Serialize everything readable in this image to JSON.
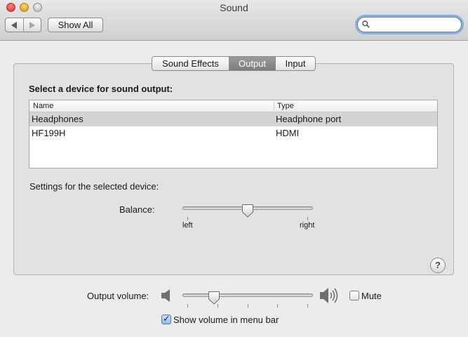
{
  "window": {
    "title": "Sound"
  },
  "toolbar": {
    "back_icon": "chevron-left-icon",
    "forward_icon": "chevron-right-icon",
    "show_all_label": "Show All",
    "search_value": "",
    "search_placeholder": ""
  },
  "tabs": [
    {
      "label": "Sound Effects",
      "selected": false
    },
    {
      "label": "Output",
      "selected": true
    },
    {
      "label": "Input",
      "selected": false
    }
  ],
  "output": {
    "heading": "Select a device for sound output:",
    "columns": {
      "name": "Name",
      "type": "Type"
    },
    "devices": [
      {
        "name": "Headphones",
        "type": "Headphone port",
        "selected": true
      },
      {
        "name": "HF199H",
        "type": "HDMI",
        "selected": false
      }
    ],
    "settings_label": "Settings for the selected device:",
    "balance": {
      "label": "Balance:",
      "left_label": "left",
      "right_label": "right",
      "value": 0.5
    }
  },
  "bottom": {
    "output_volume_label": "Output volume:",
    "output_volume_value": 0.22,
    "mute_label": "Mute",
    "mute_checked": false,
    "show_volume_label": "Show volume in menu bar",
    "show_volume_checked": true
  },
  "colors": {
    "selected_row": "#d4d4d4",
    "selected_tab": "#8a8a8a",
    "focus_ring": "#7fb1e8"
  }
}
